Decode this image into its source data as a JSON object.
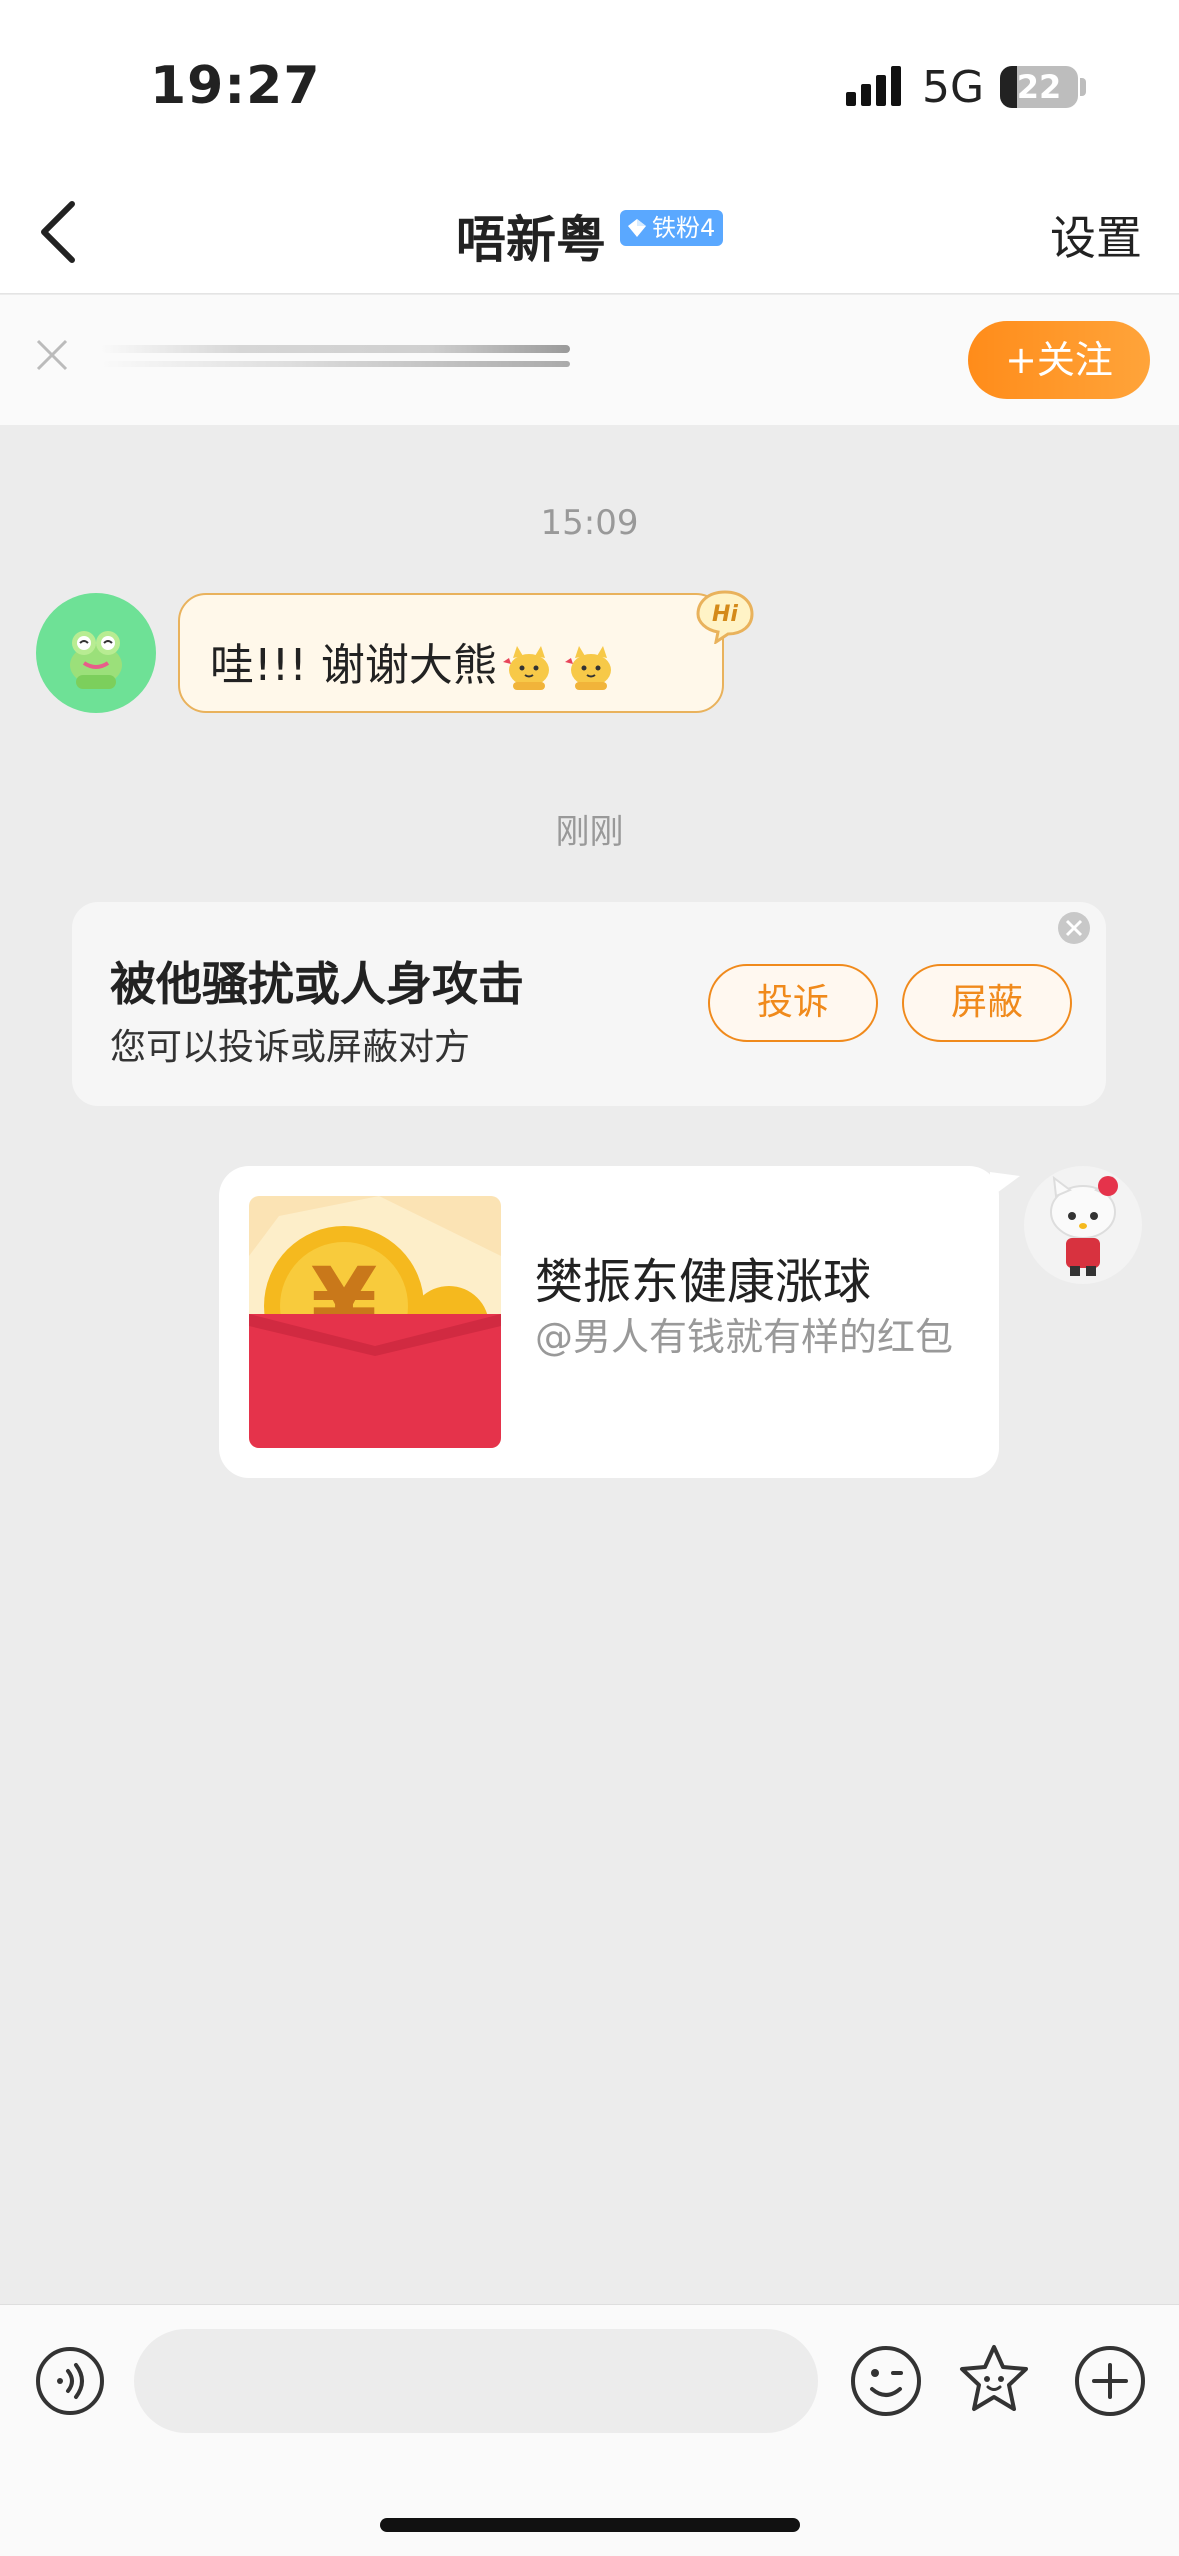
{
  "status": {
    "time": "19:27",
    "network": "5G",
    "battery": "22",
    "battery_level": 0.22
  },
  "nav": {
    "title": "唔新粤",
    "fan_badge": "铁粉4",
    "settings": "设置"
  },
  "follow": {
    "button": "+关注"
  },
  "messages": {
    "time1": "15:09",
    "incoming_text": "哇!!! 谢谢大熊",
    "hi_badge": "Hi",
    "time2": "刚刚"
  },
  "report": {
    "title": "被他骚扰或人身攻击",
    "subtitle": "您可以投诉或屏蔽对方",
    "complain": "投诉",
    "block": "屏蔽"
  },
  "red_packet": {
    "title": "樊振东健康涨球",
    "subtitle": "@男人有钱就有样的红包"
  },
  "input": {
    "placeholder": ""
  },
  "colors": {
    "accent": "#f08a1c",
    "follow_gradient": "#ff8c1a",
    "fan_badge": "#5aa8ff",
    "avatar_green": "#6ee196"
  },
  "icons": [
    "back-arrow-icon",
    "diamond-icon",
    "close-icon",
    "frog-avatar-icon",
    "cat-emoji-icon",
    "hi-sticker-icon",
    "red-packet-icon",
    "hello-kitty-avatar-icon",
    "voice-icon",
    "emoji-icon",
    "star-icon",
    "plus-icon"
  ]
}
